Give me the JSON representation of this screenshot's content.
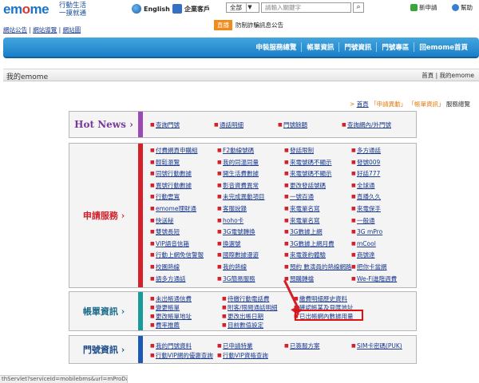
{
  "header": {
    "logo": "emome",
    "slogan_1": "行動生活",
    "slogan_2": "一摸就通",
    "lang_en": "English",
    "enterprise": "企業客戶",
    "search_scope": "全部",
    "search_placeholder": "請輸入關鍵字",
    "new_apply": "新申請",
    "help": "幫助"
  },
  "top_links": [
    "網站公告",
    "網站導覽",
    "網站圖"
  ],
  "announcement": {
    "badge": "直播",
    "text": "防制詐騙訊息公告"
  },
  "nav": [
    "申裝服務總覽",
    "帳單資訊",
    "門號資訊",
    "門號專區",
    "回emome首頁"
  ],
  "crumb": {
    "title": "我的emome",
    "path": "首頁 | 我的emome"
  },
  "tags": {
    "prefix": "首頁",
    "t1": "「申請異動」",
    "t2": "「帳單資訊」",
    "tail": "服務總覽"
  },
  "hotnews": {
    "label": "Hot News",
    "items": [
      "查詢門號",
      "通話明細",
      "門號餘額",
      "查詢網內/外門號"
    ]
  },
  "apply": {
    "label": "申請服務",
    "rows": [
      [
        "付費網頁申購組",
        "F2動線號碼",
        "發話限制",
        "多方通話"
      ],
      [
        "輕鬆瀏覽",
        "我的同溫同量",
        "來電號碼不顯示",
        "發號009"
      ],
      [
        "同號行動數據",
        "開生活費數據",
        "來電號碼不顯示",
        "好話777"
      ],
      [
        "異號行動數據",
        "影音資費異常",
        "更改發話號碼",
        "全球通"
      ],
      [
        "行動雲寬",
        "未完成異動項目",
        "一號百通",
        "直播久久"
      ],
      [
        "emome理財通",
        "客服說錄",
        "來電單名寫",
        "來電保手"
      ],
      [
        "快送秘",
        "hoho卡",
        "來電單名寫",
        "一般通"
      ],
      [
        "雙號長短",
        "3G電號轉換",
        "3G數據上網",
        "3G mPro"
      ],
      [
        "VIP語音信箱",
        "換選號",
        "3G數據上網月費",
        "mCool"
      ],
      [
        "行動上網免信警報",
        "國際數據漫遊",
        "來電簽約體驗",
        "商號達"
      ],
      [
        "校園熱線",
        "我的熱線",
        "預約 數演員的熱線網路",
        "把你卡當網"
      ],
      [
        "語多方通話",
        "3G簡易服務",
        "預購轉檔",
        "We-Fi進階週費"
      ]
    ]
  },
  "billing": {
    "label": "帳單資訊",
    "rows": [
      [
        "未出帳通信費",
        "待繳行動電話費",
        "繳費明細歷史資料"
      ],
      [
        "變更帳單",
        "附客/限閱通話明細",
        "確認帳某及貝匯地址"
      ],
      [
        "更改帳單地址",
        "更改出帳日期",
        "已出帳網內數據用量"
      ],
      [
        "費率推薦",
        "目前數值設定",
        ""
      ]
    ]
  },
  "number": {
    "label": "門號資訊",
    "rows": [
      [
        "我的門號資料",
        "已申請特業",
        "已簽服方案",
        "SIM卡密碼(PUK)"
      ],
      [
        "行動VIP網的優惠查詢",
        "行動VIP資格查詢",
        "",
        ""
      ]
    ]
  },
  "status_text": "thServlet?serviceId=mobilebms&url=mProData.jsp"
}
